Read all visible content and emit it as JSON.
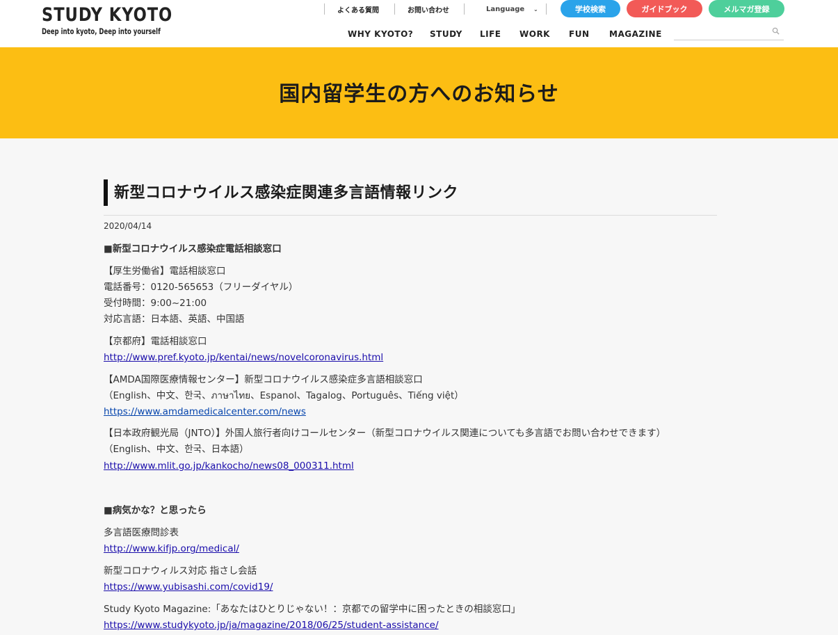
{
  "header": {
    "logo_title": "STUDY KYOTO",
    "logo_sub": "Deep into kyoto, Deep into yourself",
    "utility": {
      "faq": "よくある質問",
      "contact": "お問い合わせ",
      "language": "Language"
    },
    "buttons": {
      "school_search": "学校検索",
      "guidebook": "ガイドブック",
      "newsletter": "メルマガ登録"
    },
    "nav": [
      "WHY KYOTO?",
      "STUDY",
      "LIFE",
      "WORK",
      "FUN",
      "MAGAZINE"
    ],
    "search": {
      "placeholder": ""
    }
  },
  "banner": {
    "title": "国内留学生の方へのお知らせ"
  },
  "article": {
    "title": "新型コロナウイルス感染症関連多言語情報リンク",
    "date": "2020/04/14",
    "section1_heading": "■新型コロナウイルス感染症電話相談窓口",
    "mhlw": {
      "name": "【厚生労働省】電話相談窓口",
      "phone": "電話番号：0120-565653（フリーダイヤル）",
      "hours": "受付時間：9:00~21:00",
      "languages": "対応言語：日本語、英語、中国語"
    },
    "kyoto_pref": {
      "name": "【京都府】電話相談窓口",
      "url": "http://www.pref.kyoto.jp/kentai/news/novelcoronavirus.html"
    },
    "amda": {
      "name": "【AMDA国際医療情報センター】新型コロナウイルス感染症多言語相談窓口",
      "languages": "（English、中文、한국、ภาษาไทย、Espanol、Tagalog、Português、Tiếng việt）",
      "url": "https://www.amdamedicalcenter.com/news"
    },
    "jnto": {
      "name": "【日本政府観光局（JNTO）】外国人旅行者向けコールセンター（新型コロナウイルス関連についても多言語でお問い合わせできます）",
      "languages": "（English、中文、한국、日本語）",
      "url": "http://www.mlit.go.jp/kankocho/news08_000311.html"
    },
    "section2_heading": "■病気かな？と思ったら",
    "medical_form": {
      "name": "多言語医療問診表",
      "url": "http://www.kifjp.org/medical/"
    },
    "yubisashi": {
      "name": "新型コロナウィルス対応 指さし会話",
      "url": "https://www.yubisashi.com/covid19/"
    },
    "magazine": {
      "name": "Study Kyoto Magazine:「あなたはひとりじゃない！：京都での留学中に困ったときの相談窓口」",
      "url": "https://www.studykyoto.jp/ja/magazine/2018/06/25/student-assistance/"
    }
  }
}
